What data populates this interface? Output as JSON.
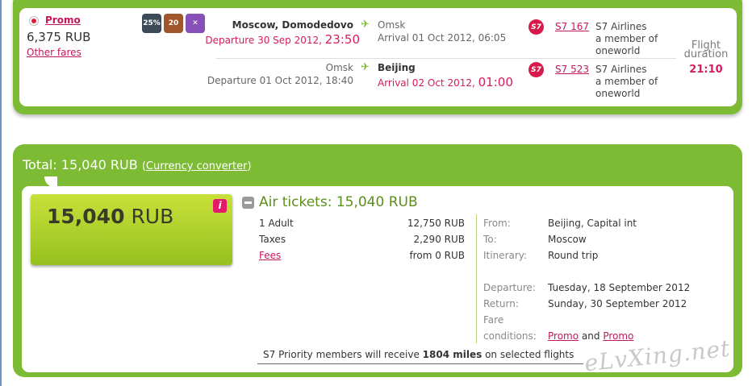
{
  "offer": {
    "fare_name": "Promo",
    "price": "6,375 RUB",
    "other_fares": "Other fares",
    "icons": [
      {
        "name": "discount-25-icon",
        "label": "25%"
      },
      {
        "name": "baggage-20kg-icon",
        "label": "20"
      },
      {
        "name": "no-refund-icon",
        "label": "✕"
      }
    ]
  },
  "segments": [
    {
      "from_city": "Moscow, Domodedovo",
      "depart_label": "Departure 30 Sep 2012,",
      "depart_time": "23:50",
      "to_city": "Omsk",
      "arrive_label": "Arrival 01 Oct 2012, 06:05",
      "arrive_time": "",
      "carrier_logo": "S7",
      "flight": "S7 167",
      "airline": [
        "S7 Airlines",
        "a member of",
        "oneworld"
      ]
    },
    {
      "from_city": "Omsk",
      "depart_label": "Departure 01 Oct 2012, 18:40",
      "depart_time": "",
      "to_city": "Beijing",
      "arrive_label": "Arrival 02 Oct 2012,",
      "arrive_time": "01:00",
      "carrier_logo": "S7",
      "flight": "S7 523",
      "airline": [
        "S7 Airlines",
        "a member of",
        "oneworld"
      ]
    }
  ],
  "duration": {
    "label_1": "Flight",
    "label_2": "duration",
    "value": "21:10"
  },
  "total": {
    "label": "Total",
    "amount": "15,040 RUB",
    "converter": "Currency converter",
    "big_amount": "15,040",
    "big_currency": "RUB",
    "info_glyph": "i"
  },
  "air_tickets": {
    "title": "Air tickets: 15,040 RUB",
    "rows": [
      {
        "label": "1 Adult",
        "amount": "12,750 RUB"
      },
      {
        "label": "Taxes",
        "amount": "2,290 RUB"
      },
      {
        "label": "Fees",
        "amount": "from 0 RUB"
      }
    ]
  },
  "trip": {
    "from_label": "From:",
    "from_value": "Beijing, Capital int",
    "to_label": "To:",
    "to_value": "Moscow",
    "itinerary_label": "Itinerary:",
    "itinerary_value": "Round trip",
    "departure_label": "Departure:",
    "departure_value": "Tuesday, 18 September 2012",
    "return_label": "Return:",
    "return_value": "Sunday, 30 September 2012",
    "fare_label_1": "Fare",
    "fare_label_2": "conditions:",
    "fare_link_1": "Promo",
    "fare_and": "and",
    "fare_link_2": "Promo"
  },
  "miles": {
    "prefix": "S7 Priority members will receive ",
    "miles": "1804 miles",
    "suffix": " on selected flights"
  },
  "watermark": "eLvXing.net",
  "colors": {
    "green": "#7dbb34",
    "pink": "#d81b60",
    "lime": "#b5d22e"
  }
}
